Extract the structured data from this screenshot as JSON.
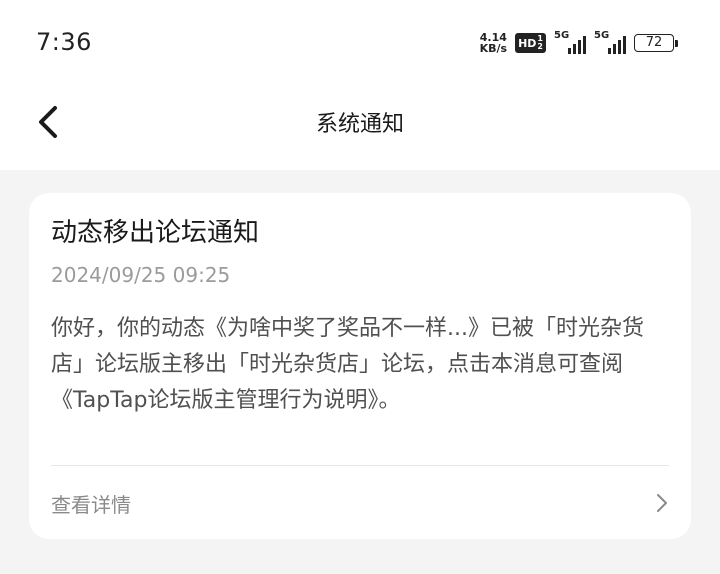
{
  "status_bar": {
    "time": "7:36",
    "net_speed_value": "4.14",
    "net_speed_unit": "KB/s",
    "hd_label": "HD",
    "hd_sub_top": "1",
    "hd_sub_bottom": "2",
    "sim1_label": "5G",
    "sim2_label": "5G",
    "battery": "72"
  },
  "nav": {
    "back_icon": "chevron-left-icon",
    "title": "系统通知"
  },
  "notification": {
    "title": "动态移出论坛通知",
    "time": "2024/09/25 09:25",
    "body": "你好，你的动态《为啥中奖了奖品不一样...》已被「时光杂货店」论坛版主移出「时光杂货店」论坛，点击本消息可查阅《TapTap论坛版主管理行为说明》。",
    "detail_label": "查看详情",
    "detail_icon": "chevron-right-icon"
  }
}
